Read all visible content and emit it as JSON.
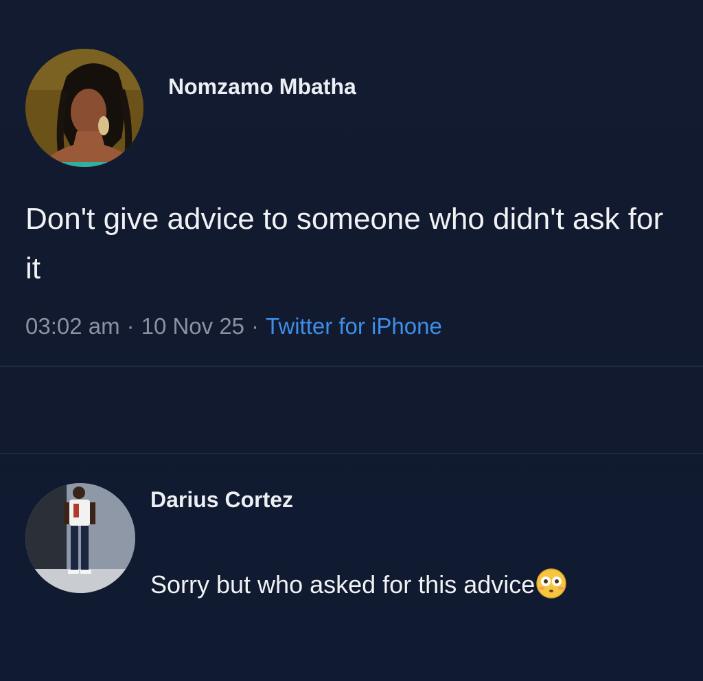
{
  "tweet": {
    "author_name": "Nomzamo Mbatha",
    "avatar_description_icon": "profile-photo-woman",
    "text": "Don't give advice to someone who didn't ask for it",
    "time": "03:02 am",
    "separator": "·",
    "date": "10 Nov 25",
    "source": "Twitter for iPhone"
  },
  "reply": {
    "author_name": "Darius Cortez",
    "avatar_description_icon": "profile-photo-man",
    "text": "Sorry but who asked for this advice",
    "emoji_icon": "flushed-face-emoji"
  },
  "colors": {
    "background": "#111b31",
    "primary_text": "#f1f2f4",
    "secondary_text": "#8b93a3",
    "link": "#3f8ee8",
    "divider": "#1e2a44"
  }
}
